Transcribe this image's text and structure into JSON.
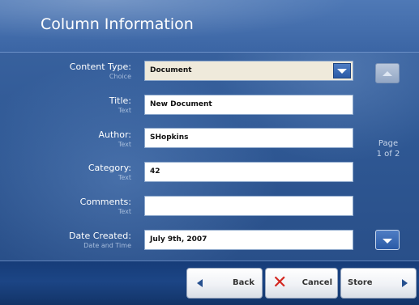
{
  "header": {
    "title": "Column Information"
  },
  "form": {
    "content_type": {
      "label": "Content Type:",
      "type": "Choice",
      "value": "Document"
    },
    "title": {
      "label": "Title:",
      "type": "Text",
      "value": "New Document"
    },
    "author": {
      "label": "Author:",
      "type": "Text",
      "value": "SHopkins"
    },
    "category": {
      "label": "Category:",
      "type": "Text",
      "value": "42"
    },
    "comments": {
      "label": "Comments:",
      "type": "Text",
      "value": ""
    },
    "date_created": {
      "label": "Date Created:",
      "type": "Date and Time",
      "value": "July 9th, 2007"
    }
  },
  "pager": {
    "line1": "Page",
    "line2": "1 of 2"
  },
  "buttons": {
    "back": "Back",
    "cancel": "Cancel",
    "store": "Store"
  },
  "icons": {
    "dropdown": "chevron-down-icon",
    "scroll_up": "chevron-up-icon",
    "scroll_down": "chevron-down-icon",
    "back": "arrow-left-icon",
    "cancel": "close-icon",
    "store": "arrow-right-icon"
  },
  "colors": {
    "accent": "#2a5aa6",
    "cancel_icon": "#d3261f",
    "background": "#2f5894"
  }
}
